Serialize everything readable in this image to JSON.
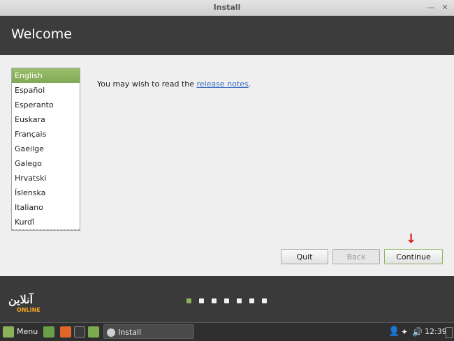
{
  "window": {
    "title": "Install"
  },
  "header": {
    "title": "Welcome"
  },
  "languages": {
    "selected": "English",
    "items": [
      "English",
      "Español",
      "Esperanto",
      "Euskara",
      "Français",
      "Gaeilge",
      "Galego",
      "Hrvatski",
      "Íslenska",
      "Italiano",
      "Kurdî"
    ]
  },
  "release": {
    "prefix": "You may wish to read the ",
    "link": "release notes",
    "suffix": "."
  },
  "buttons": {
    "quit": "Quit",
    "back": "Back",
    "continue": "Continue"
  },
  "progress": {
    "total_steps": 7,
    "current_step": 1
  },
  "watermark": {
    "title": "آنلاین",
    "subtitle": "ONLINE"
  },
  "taskbar": {
    "menu_label": "Menu",
    "task_label": "Install",
    "clock": "12:39"
  },
  "colors": {
    "accent": "#8bb35a",
    "header": "#3c3c3c",
    "link": "#3a6fc2",
    "arrow": "#e01010"
  }
}
